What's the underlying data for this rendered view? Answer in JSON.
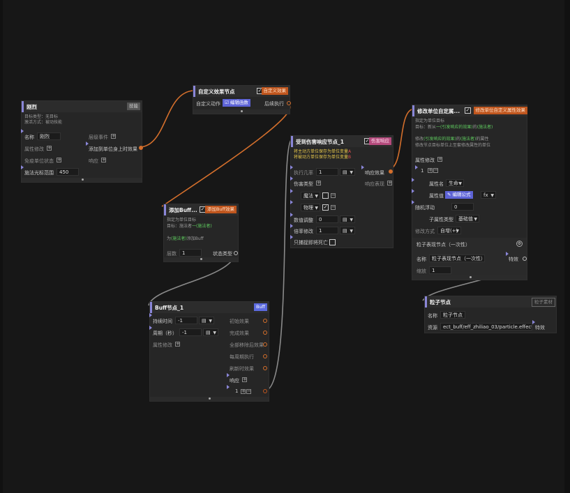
{
  "node_riling": {
    "title": "刚烈",
    "tag": "技能",
    "desc1": "目标类型：无目标",
    "desc2": "激活方式：被动技能",
    "name_label": "名称",
    "name_value": "刚烈",
    "props_label": "属性修改",
    "immune_label": "免疫单位状态",
    "range_label": "施法光标范围",
    "range_value": "450",
    "layer_event": "层级事件",
    "add_unit_effect": "添加到单位身上时效果",
    "response": "响应"
  },
  "node_custom_effect": {
    "title": "自定义效果节点",
    "tag": "自定义效果",
    "action_label": "自定义动作",
    "edit_btn": "编辑函数",
    "after_exec": "后续执行"
  },
  "node_add_buff": {
    "title": "添加Buff...",
    "tag": "添加Buff效果",
    "desc1": "指定为单位目标",
    "desc2a": "目标：施法者",
    "desc2b": "一(施法者)",
    "desc3a": "为",
    "desc3b": "(施法者)",
    "desc3c": "添加Buff",
    "layers_label": "层数",
    "layers_value": "1",
    "state_type": "状态类型"
  },
  "node_damage_resp": {
    "title": "受到伤害响应节点_1",
    "tag": "伤害响应",
    "desc1a": "将主动方单位保存为单位变量",
    "desc1b": "A",
    "desc2a": "将被动方单位保存为单位变量",
    "desc2b": "B",
    "prob_label": "执行几率",
    "prob_value": "1",
    "resp_effect": "响应效果",
    "dmg_type": "伤害类型",
    "resp_show": "响应表现",
    "magic": "魔法",
    "physical": "物理",
    "adjust_label": "数值调整",
    "adjust_value": "0",
    "rate_label": "倍率修改",
    "rate_value": "1",
    "capture_death": "只捕捉即将死亡"
  },
  "node_modify_unit": {
    "title": "修改单位自定属...",
    "tag": "修改单位自定义属性效果",
    "desc1": "指定为单位目标",
    "desc2a": "目标：新从",
    "desc2b": "一(引发响应的效果)",
    "desc2c": "的",
    "desc2d": "(施法者)",
    "desc3a": "修改",
    "desc3b": "(引发响应的效果)",
    "desc3c": "的",
    "desc3d": "(施法者)",
    "desc3e": "的属性",
    "desc4": "修改节点目标单位上至套修改属性的单位",
    "props_label": "属性修改",
    "index": "1",
    "attr_name_label": "属性名",
    "attr_name_value": "生命",
    "attr_val_label": "属性值",
    "edit_formula": "编辑公式",
    "fx": "fx",
    "random_label": "随机浮动",
    "random_value": "0",
    "sub_type_label": "子属性类型",
    "sub_type_value": "基础值",
    "mode_label": "修改方式",
    "mode_value": "自增(+)"
  },
  "node_particle_once": {
    "title": "粒子表现节点（一次性）",
    "name_label": "名称",
    "name_value": "粒子表现节点（一次性）",
    "effect_label": "特效",
    "scale_label": "缩放",
    "scale_value": "1"
  },
  "node_buff": {
    "title": "Buff节点_1",
    "tag": "Buff",
    "duration_label": "持续时间",
    "duration_value": "-1",
    "period_label": "周期（秒）",
    "period_value": "-1",
    "props_label": "属性修改",
    "init_effect": "初始效果",
    "finish_effect": "完成效果",
    "remove_effect": "全部移除后效果",
    "period_exec": "每周期执行",
    "refresh_effect": "刷新时效果",
    "response": "响应",
    "resp_index": "1"
  },
  "node_particle": {
    "title": "粒子节点",
    "tag": "粒子素材",
    "name_label": "名称",
    "name_value": "粒子节点",
    "res_label": "资源",
    "res_value": "ect_buff/eff_zhiliao_03/particle.effect",
    "effect_label": "特效"
  },
  "colors": {
    "wire_orange": "#d46f2c",
    "wire_gray": "#8a8a8a",
    "accent_purple": "#8a86d8"
  }
}
